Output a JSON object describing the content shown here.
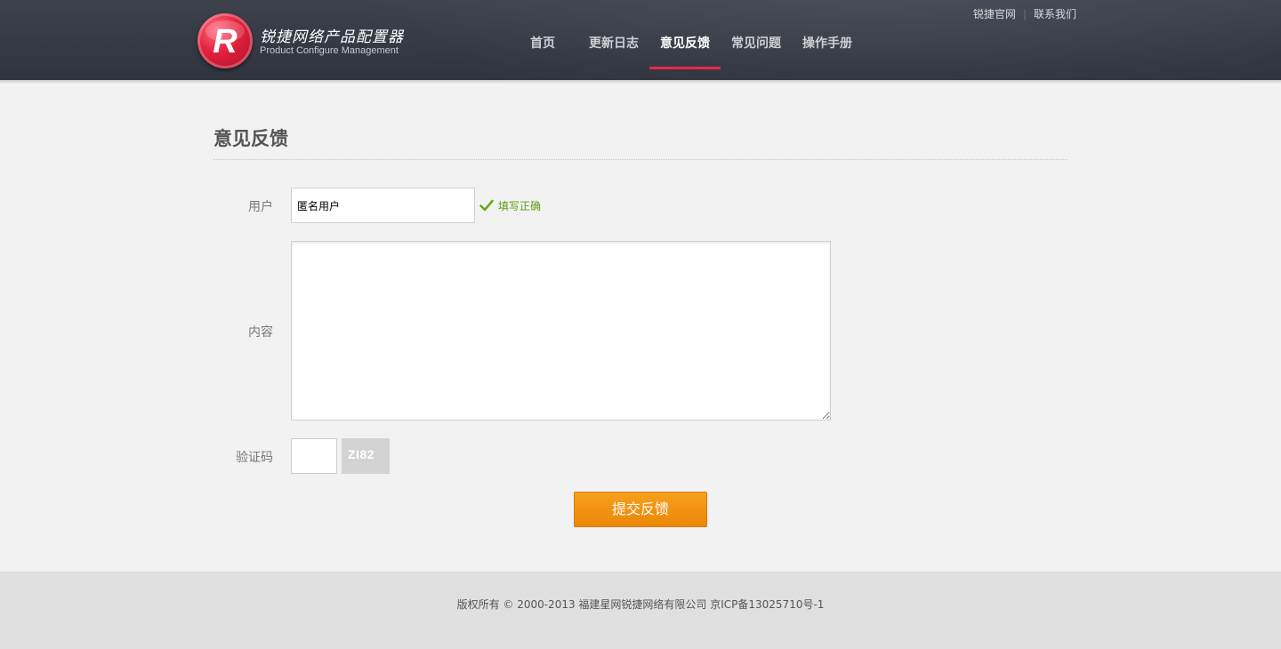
{
  "header": {
    "logo": {
      "letter": "R",
      "title": "锐捷网络产品配置器",
      "subtitle": "Product Configure Management"
    },
    "top_links": [
      {
        "label": "锐捷官网"
      },
      {
        "label": "联系我们"
      }
    ],
    "nav": [
      {
        "label": "首页",
        "active": false
      },
      {
        "label": "更新日志",
        "active": false
      },
      {
        "label": "意见反馈",
        "active": true
      },
      {
        "label": "常见问题",
        "active": false
      },
      {
        "label": "操作手册",
        "active": false
      }
    ]
  },
  "main": {
    "title": "意见反馈",
    "form": {
      "user_label": "用户",
      "user_value": "匿名用户",
      "user_valid_msg": "填写正确",
      "content_label": "内容",
      "content_value": "",
      "captcha_label": "验证码",
      "captcha_value": "",
      "captcha_image_text": "ZI82",
      "submit_label": "提交反馈"
    }
  },
  "footer": {
    "copyright": "版权所有 © 2000-2013 福建星网锐捷网络有限公司 京ICP备13025710号-1"
  },
  "colors": {
    "header_bg": "#353943",
    "nav_active_underline": "#e8264b",
    "valid_green": "#5a9d13",
    "submit_orange": "#f0900f",
    "logo_red": "#e0203c",
    "page_bg": "#f2f2f2",
    "footer_bg": "#e0e0e0"
  },
  "icons": {
    "logo": "ruijie-r-logo-badge",
    "valid": "check-icon"
  }
}
